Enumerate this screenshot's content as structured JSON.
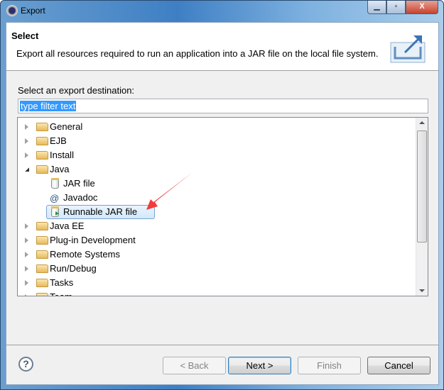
{
  "window": {
    "title": "Export",
    "controls": [
      "minimize",
      "maximize",
      "close"
    ]
  },
  "header": {
    "title": "Select",
    "description": "Export all resources required to run an application into a JAR file on the local file system.",
    "icon": "export-wizard-icon"
  },
  "filter": {
    "label": "Select an export destination:",
    "value": "type filter text"
  },
  "tree": {
    "items": [
      {
        "label": "General",
        "type": "folder",
        "expanded": false
      },
      {
        "label": "EJB",
        "type": "folder",
        "expanded": false
      },
      {
        "label": "Install",
        "type": "folder",
        "expanded": false
      },
      {
        "label": "Java",
        "type": "folder",
        "expanded": true
      },
      {
        "label": "JAR file",
        "type": "jar",
        "child": true
      },
      {
        "label": "Javadoc",
        "type": "javadoc",
        "child": true
      },
      {
        "label": "Runnable JAR file",
        "type": "runnable-jar",
        "child": true,
        "selected": true
      },
      {
        "label": "Java EE",
        "type": "folder",
        "expanded": false
      },
      {
        "label": "Plug-in Development",
        "type": "folder",
        "expanded": false
      },
      {
        "label": "Remote Systems",
        "type": "folder",
        "expanded": false
      },
      {
        "label": "Run/Debug",
        "type": "folder",
        "expanded": false
      },
      {
        "label": "Tasks",
        "type": "folder",
        "expanded": false
      },
      {
        "label": "Team",
        "type": "folder",
        "expanded": false
      }
    ]
  },
  "annotation": {
    "color": "#f03c3c",
    "points_to": "Runnable JAR file"
  },
  "buttons": {
    "back": "< Back",
    "next": "Next >",
    "finish": "Finish",
    "cancel": "Cancel",
    "back_enabled": false,
    "finish_enabled": false
  }
}
